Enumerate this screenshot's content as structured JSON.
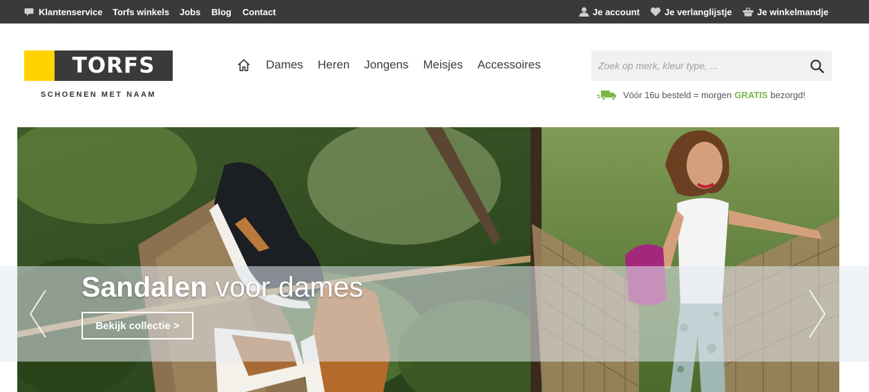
{
  "topbar": {
    "left_links": [
      "Klantenservice",
      "Torfs winkels",
      "Jobs",
      "Blog",
      "Contact"
    ],
    "account": "Je account",
    "wishlist": "Je verlanglijstje",
    "cart": "Je winkelmandje"
  },
  "header": {
    "logo_text": "TORFS",
    "tagline": "SCHOENEN MET NAAM",
    "nav": [
      "Dames",
      "Heren",
      "Jongens",
      "Meisjes",
      "Accessoires"
    ],
    "search_placeholder": "Zoek op merk, kleur type, ...",
    "delivery": {
      "before": "Vóór 16u besteld = morgen",
      "highlight": "GRATIS",
      "after": "bezorgd!"
    }
  },
  "hero": {
    "title_bold": "Sandalen",
    "title_rest": "voor dames",
    "cta": "Bekijk collectie >"
  },
  "colors": {
    "topbar": "#3a3a3a",
    "logo_yellow": "#ffd200",
    "gratis_green": "#7ab648"
  },
  "icons": [
    "chat-icon",
    "user-icon",
    "heart-icon",
    "basket-icon",
    "home-icon",
    "search-icon",
    "truck-icon",
    "chevron-left-icon",
    "chevron-right-icon"
  ]
}
